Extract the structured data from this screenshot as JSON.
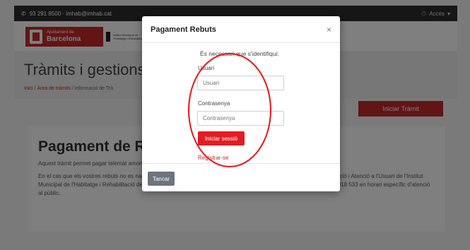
{
  "topbar": {
    "contact": "93 291 8500 · imhab@imhab.cat",
    "access": "Accés"
  },
  "logo": {
    "line1": "Ajuntament de",
    "line2": "Barcelona",
    "secondary": "Institut Municipal de l'Habitatge i Rehabilitació"
  },
  "hero": {
    "title": "Tràmits i gestions",
    "breadcrumb": {
      "home": "Inici",
      "sep": "/",
      "area": "Àrea de tràmits",
      "current": "Informació de Trà"
    }
  },
  "start_button": "Iniciar Tràmit",
  "content": {
    "title": "Pagament de Rebu",
    "para1": "Aquest tràmit permet pagar telemàt                                                    amortització d'habitatges, locals i places d'aparcament del parc públic",
    "para2": "En el cas que els vostres rebuts no es                                                    nades mitjançant la presentació d'instàncies que teniu disponible en                                                    ina d'Informació i Atenció a l'Usuari de l'Institut Municipal de l'Habitatge i Rehabilitació de Barcelona a través del correu electrònic imhab@imhab.cat o del telèfon: 932 918 533 en horari específic d'atenció al públic."
  },
  "modal": {
    "title": "Pagament Rebuts",
    "close": "×",
    "notice": "És necessari que s'identifiqui:",
    "user_label": "Usuari",
    "user_placeholder": "Usuari",
    "password_label": "Contrasenya",
    "password_placeholder": "Contrasenya",
    "login_button": "Iniciar sessió",
    "register_link": "Registrar-se",
    "footer_button": "Tancar"
  },
  "colors": {
    "accent": "#c62828",
    "button_red": "#e31b23",
    "annotation": "#e8141c"
  }
}
